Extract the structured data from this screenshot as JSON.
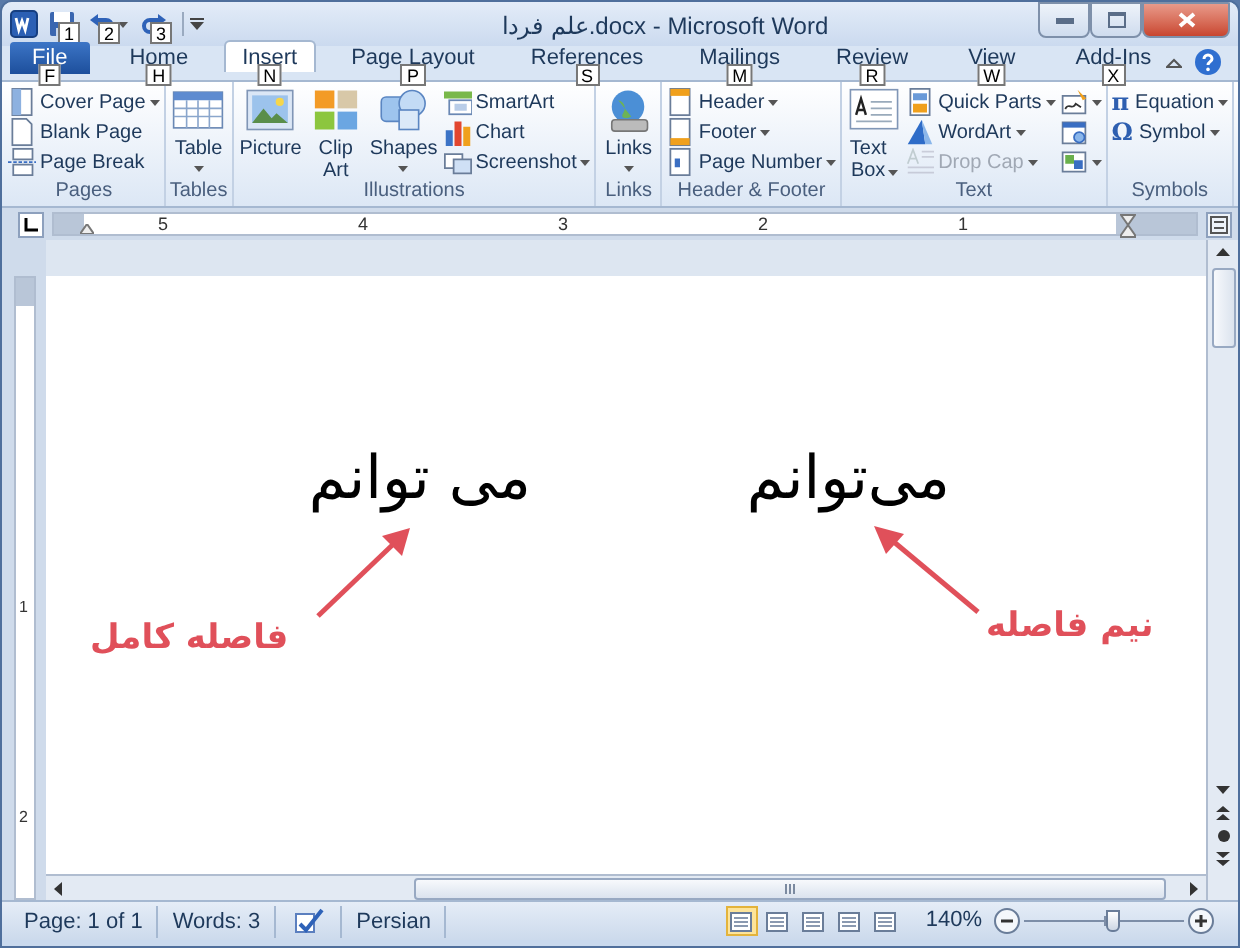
{
  "window": {
    "title": "علم فردا.docx - Microsoft Word"
  },
  "quick_access": [
    {
      "keytip": "1",
      "dropdown": false
    },
    {
      "keytip": "2",
      "dropdown": true
    },
    {
      "keytip": "3",
      "dropdown": false
    }
  ],
  "tabs": [
    {
      "label": "File",
      "kind": "backstage",
      "selected": false,
      "keytip": "F"
    },
    {
      "label": "Home",
      "kind": "tab",
      "selected": false,
      "keytip": "H"
    },
    {
      "label": "Insert",
      "kind": "tab",
      "selected": true,
      "keytip": "N"
    },
    {
      "label": "Page Layout",
      "kind": "tab",
      "selected": false,
      "keytip": "P"
    },
    {
      "label": "References",
      "kind": "tab",
      "selected": false,
      "keytip": "S"
    },
    {
      "label": "Mailings",
      "kind": "tab",
      "selected": false,
      "keytip": "M"
    },
    {
      "label": "Review",
      "kind": "tab",
      "selected": false,
      "keytip": "R"
    },
    {
      "label": "View",
      "kind": "tab",
      "selected": false,
      "keytip": "W"
    },
    {
      "label": "Add-Ins",
      "kind": "tab",
      "selected": false,
      "keytip": "X"
    }
  ],
  "ribbon_groups": [
    {
      "label": "Pages",
      "columns": [
        [
          {
            "kind": "small",
            "label": "Cover Page",
            "dropdown": true
          },
          {
            "kind": "small",
            "label": "Blank Page",
            "dropdown": false
          },
          {
            "kind": "small",
            "label": "Page Break",
            "dropdown": false
          }
        ]
      ]
    },
    {
      "label": "Tables",
      "columns": [
        [
          {
            "kind": "large",
            "label": "Table",
            "dropdown": true
          }
        ]
      ]
    },
    {
      "label": "Illustrations",
      "columns": [
        [
          {
            "kind": "large",
            "label": "Picture",
            "dropdown": false
          }
        ],
        [
          {
            "kind": "large",
            "label": "Clip Art",
            "dropdown": false
          }
        ],
        [
          {
            "kind": "large",
            "label": "Shapes",
            "dropdown": true
          }
        ],
        [
          {
            "kind": "small",
            "label": "SmartArt",
            "dropdown": false
          },
          {
            "kind": "small",
            "label": "Chart",
            "dropdown": false
          },
          {
            "kind": "small",
            "label": "Screenshot",
            "dropdown": true
          }
        ]
      ]
    },
    {
      "label": "Links",
      "columns": [
        [
          {
            "kind": "large",
            "label": "Links",
            "dropdown": true
          }
        ]
      ]
    },
    {
      "label": "Header & Footer",
      "columns": [
        [
          {
            "kind": "small",
            "label": "Header",
            "dropdown": true
          },
          {
            "kind": "small",
            "label": "Footer",
            "dropdown": true
          },
          {
            "kind": "small",
            "label": "Page Number",
            "dropdown": true
          }
        ]
      ]
    },
    {
      "label": "Text",
      "columns": [
        [
          {
            "kind": "large",
            "label": "Text Box",
            "dropdown": true
          }
        ],
        [
          {
            "kind": "small",
            "label": "Quick Parts",
            "dropdown": true,
            "disabled": false
          },
          {
            "kind": "small",
            "label": "WordArt",
            "dropdown": true,
            "disabled": false
          },
          {
            "kind": "small",
            "label": "Drop Cap",
            "dropdown": true,
            "disabled": true
          }
        ],
        [
          {
            "kind": "icon",
            "dropdown": true
          },
          {
            "kind": "icon",
            "dropdown": false
          },
          {
            "kind": "icon",
            "dropdown": true
          }
        ]
      ]
    },
    {
      "label": "Symbols",
      "columns": [
        [
          {
            "kind": "small",
            "glyph": "π",
            "label": "Equation",
            "dropdown": true
          },
          {
            "kind": "small",
            "glyph": "Ω",
            "label": "Symbol",
            "dropdown": true
          }
        ]
      ]
    }
  ],
  "ruler": {
    "numbers": [
      "5",
      "4",
      "3",
      "2",
      "1"
    ]
  },
  "vertical_ruler": {
    "numbers": [
      "1",
      "2"
    ]
  },
  "document": {
    "words": [
      "می‌توانم",
      "می توانم"
    ]
  },
  "annotations": [
    {
      "text": "نیم فاصله",
      "color": "#e0505a"
    },
    {
      "text": "فاصله کامل",
      "color": "#e0505a"
    }
  ],
  "status_bar": {
    "page": "Page: 1 of 1",
    "words": "Words: 3",
    "language": "Persian",
    "views": [
      {
        "selected": true
      },
      {
        "selected": false
      },
      {
        "selected": false
      },
      {
        "selected": false
      },
      {
        "selected": false
      }
    ],
    "zoom": "140%",
    "zoom_slider": {
      "level": 0.56
    }
  }
}
